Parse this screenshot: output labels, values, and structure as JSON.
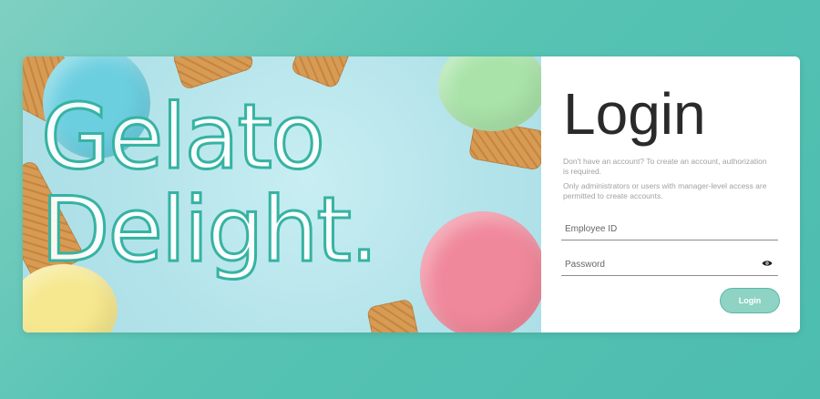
{
  "hero": {
    "title_line1": "Gelato",
    "title_line2": "Delight."
  },
  "login": {
    "title": "Login",
    "note_1": "Don't have an account? To create an account, authorization is required.",
    "note_2": "Only administrators or users with manager-level access are permitted to create accounts.",
    "employee_id_placeholder": "Employee ID",
    "password_placeholder": "Password",
    "button_label": "Login",
    "password_icon": "eye-icon"
  },
  "colors": {
    "accent": "#36b3a2",
    "button_bg": "#8ed3c4",
    "button_border": "#5ab8a7",
    "page_bg_start": "#7fd0c2",
    "page_bg_end": "#4dbdb0",
    "title_text": "#2a2a2a",
    "muted_text": "#a1a1a1"
  }
}
